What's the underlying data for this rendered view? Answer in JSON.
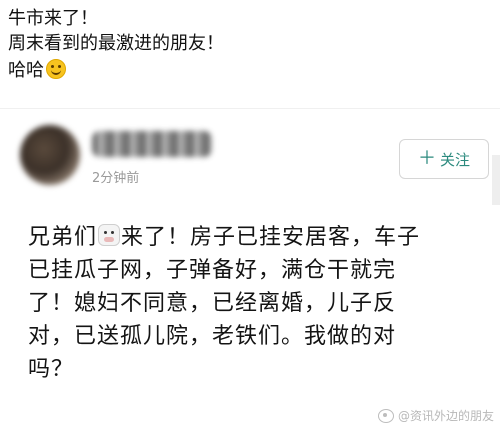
{
  "caption": {
    "line1": "牛市来了！",
    "line2": "周末看到的最激进的朋友！",
    "line3": "哈哈"
  },
  "post": {
    "time": "2分钟前",
    "follow_label": "关注",
    "follow_icon": "plus-icon",
    "lines": [
      {
        "before": "兄弟们",
        "after": "来了！房子已挂安居客，车子"
      },
      {
        "text": "已挂瓜子网，子弹备好，满仓干就完"
      },
      {
        "text": "了！媳妇不同意，已经离婚，儿子反"
      },
      {
        "text": "对，已送孤儿院，老铁们。我做的对"
      },
      {
        "text": "吗？"
      }
    ]
  },
  "watermark": {
    "text": "@资讯外边的朋友"
  },
  "icons": {
    "smile": "smile-emoji-icon",
    "cow": "cow-emoji-icon",
    "weibo": "weibo-icon"
  },
  "colors": {
    "follow_accent": "#2b8a7e",
    "time_gray": "#9a9a9a"
  }
}
